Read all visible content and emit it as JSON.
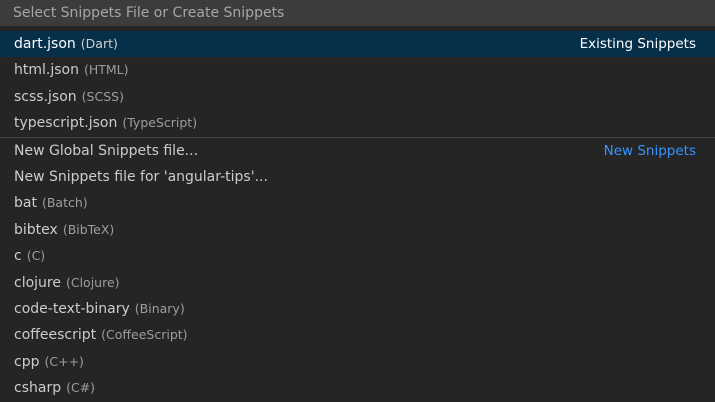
{
  "quick_pick": {
    "placeholder": "Select Snippets File or Create Snippets",
    "value": "",
    "items": [
      {
        "label": "dart.json",
        "description": "(Dart)",
        "group": "Existing Snippets"
      },
      {
        "label": "html.json",
        "description": "(HTML)"
      },
      {
        "label": "scss.json",
        "description": "(SCSS)"
      },
      {
        "label": "typescript.json",
        "description": "(TypeScript)"
      },
      {
        "label": "New Global Snippets file...",
        "group": "New Snippets"
      },
      {
        "label": "New Snippets file for 'angular-tips'..."
      },
      {
        "label": "bat",
        "description": "(Batch)"
      },
      {
        "label": "bibtex",
        "description": "(BibTeX)"
      },
      {
        "label": "c",
        "description": "(C)"
      },
      {
        "label": "clojure",
        "description": "(Clojure)"
      },
      {
        "label": "code-text-binary",
        "description": "(Binary)"
      },
      {
        "label": "coffeescript",
        "description": "(CoffeeScript)"
      },
      {
        "label": "cpp",
        "description": "(C++)"
      },
      {
        "label": "csharp",
        "description": "(C#)"
      }
    ]
  },
  "colors": {
    "background": "#252526",
    "input_background": "#3c3c3c",
    "selected_background": "#062f4a",
    "accent": "#3794ff"
  }
}
